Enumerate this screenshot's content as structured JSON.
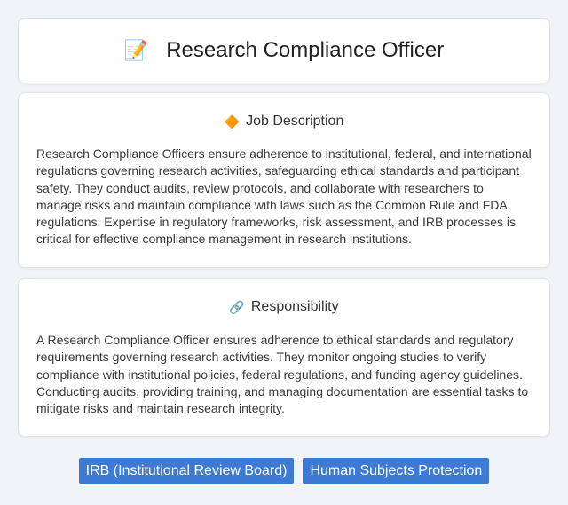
{
  "header": {
    "icon": "memo-pencil-icon",
    "title": "Research Compliance Officer"
  },
  "job_description": {
    "icon": "diamond-badge-icon",
    "heading": "Job Description",
    "text": "Research Compliance Officers ensure adherence to institutional, federal, and international regulations governing research activities, safeguarding ethical standards and participant safety. They conduct audits, review protocols, and collaborate with researchers to manage risks and maintain compliance with laws such as the Common Rule and FDA regulations. Expertise in regulatory frameworks, risk assessment, and IRB processes is critical for effective compliance management in research institutions."
  },
  "responsibility": {
    "icon": "link-icon",
    "heading": "Responsibility",
    "text": "A Research Compliance Officer ensures adherence to ethical standards and regulatory requirements governing research activities. They monitor ongoing studies to verify compliance with institutional policies, federal regulations, and funding agency guidelines. Conducting audits, providing training, and managing documentation are essential tasks to mitigate risks and maintain research integrity."
  },
  "tags": [
    {
      "label": "IRB (Institutional Review Board)"
    },
    {
      "label": "Human Subjects Protection"
    }
  ],
  "colors": {
    "background": "#f0f3f8",
    "card": "#ffffff",
    "tag": "#3d7ad6"
  }
}
